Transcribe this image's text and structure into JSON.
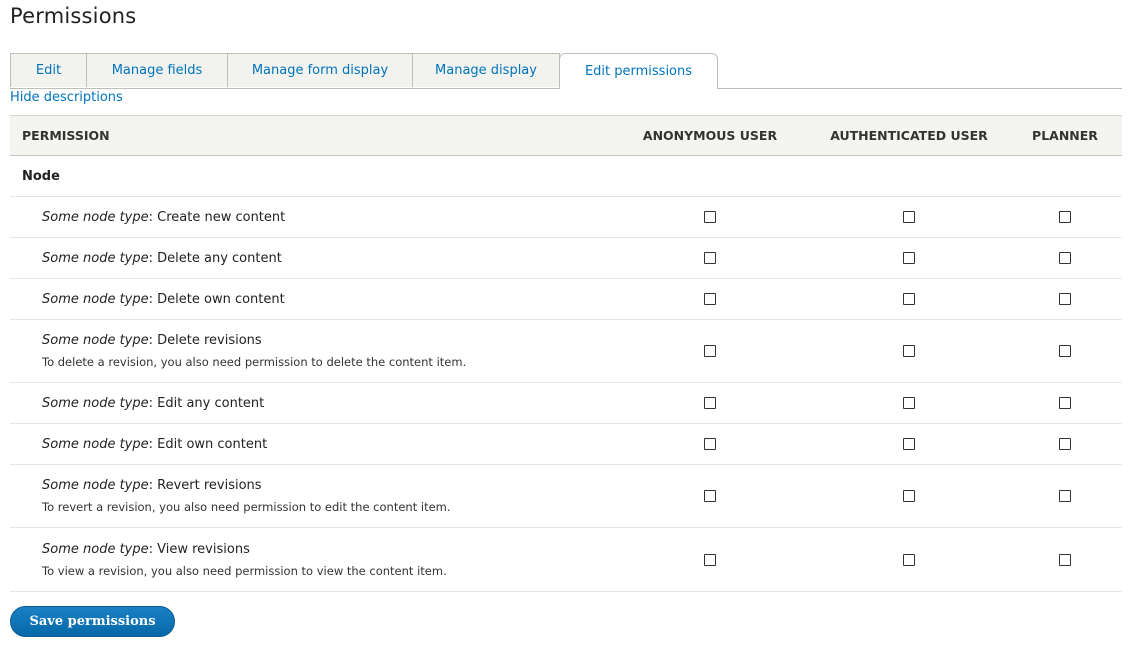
{
  "page": {
    "title": "Permissions"
  },
  "tabs": [
    {
      "label": "Edit"
    },
    {
      "label": "Manage fields"
    },
    {
      "label": "Manage form display"
    },
    {
      "label": "Manage display"
    },
    {
      "label": "Edit permissions",
      "active": true
    }
  ],
  "hide_descriptions_link": "Hide descriptions",
  "table": {
    "headers": {
      "permission": "PERMISSION",
      "anonymous": "ANONYMOUS USER",
      "authenticated": "AUTHENTICATED USER",
      "planner": "PLANNER"
    },
    "module": "Node",
    "rows": [
      {
        "type": "Some node type",
        "sep": ": ",
        "label": "Create new content",
        "desc": ""
      },
      {
        "type": "Some node type",
        "sep": ": ",
        "label": "Delete any content",
        "desc": ""
      },
      {
        "type": "Some node type",
        "sep": ": ",
        "label": "Delete own content",
        "desc": ""
      },
      {
        "type": "Some node type",
        "sep": ": ",
        "label": "Delete revisions",
        "desc": "To delete a revision, you also need permission to delete the content item."
      },
      {
        "type": "Some node type",
        "sep": ": ",
        "label": "Edit any content",
        "desc": ""
      },
      {
        "type": "Some node type",
        "sep": ": ",
        "label": "Edit own content",
        "desc": ""
      },
      {
        "type": "Some node type",
        "sep": ": ",
        "label": "Revert revisions",
        "desc": "To revert a revision, you also need permission to edit the content item."
      },
      {
        "type": "Some node type",
        "sep": ": ",
        "label": "View revisions",
        "desc": "To view a revision, you also need permission to view the content item."
      }
    ]
  },
  "save_button": "Save permissions",
  "colors": {
    "link": "#0074bd",
    "button": "#0568a8"
  }
}
